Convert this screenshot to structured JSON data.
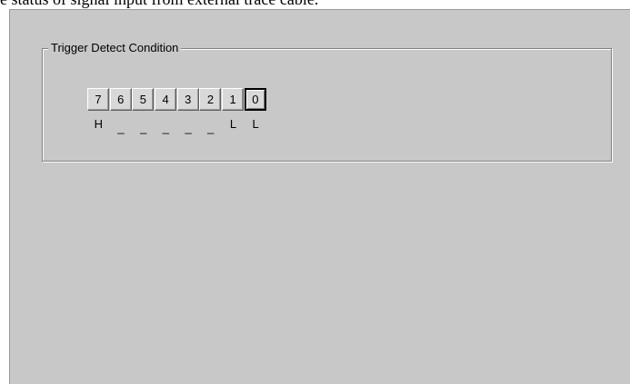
{
  "header_text": "e status of signal input from external trace cable.",
  "group": {
    "title": "Trigger Detect Condition"
  },
  "bits": [
    {
      "label": "7",
      "state": "H",
      "selected": false
    },
    {
      "label": "6",
      "state": "_",
      "selected": false
    },
    {
      "label": "5",
      "state": "_",
      "selected": false
    },
    {
      "label": "4",
      "state": "_",
      "selected": false
    },
    {
      "label": "3",
      "state": "_",
      "selected": false
    },
    {
      "label": "2",
      "state": "_",
      "selected": false
    },
    {
      "label": "1",
      "state": "L",
      "selected": false
    },
    {
      "label": "0",
      "state": "L",
      "selected": true
    }
  ],
  "colors": {
    "panel_bg": "#c8c8c8",
    "button_face": "#d8d8d8"
  }
}
